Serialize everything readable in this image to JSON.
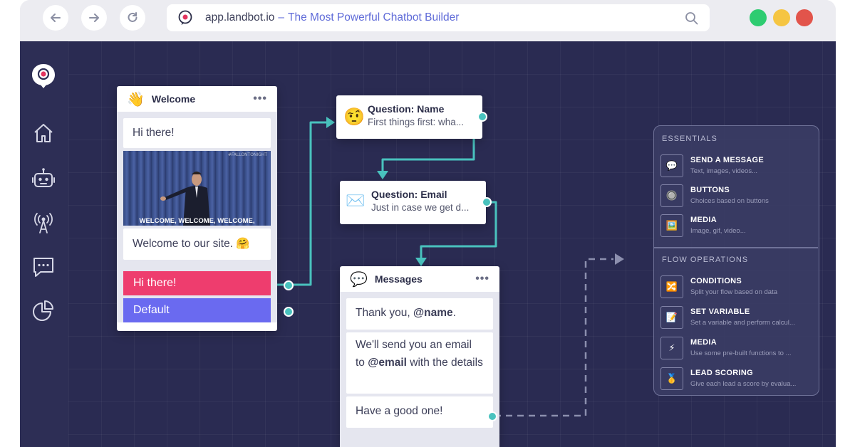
{
  "browser": {
    "url_host": "app.landbot.io",
    "url_separator": "–",
    "url_title": "The Most Powerful Chatbot Builder",
    "nav": {
      "back_icon": "arrow-left-icon",
      "forward_icon": "arrow-right-icon",
      "reload_icon": "reload-icon"
    },
    "traffic_colors": [
      "#2ecc71",
      "#f5c542",
      "#e2544b"
    ]
  },
  "sidebar": {
    "items": [
      {
        "icon": "landbot-logo-icon"
      },
      {
        "icon": "home-icon"
      },
      {
        "icon": "bot-icon"
      },
      {
        "icon": "broadcast-icon"
      },
      {
        "icon": "chat-icon"
      },
      {
        "icon": "pie-chart-icon"
      }
    ]
  },
  "welcome_card": {
    "emoji": "👋",
    "title": "Welcome",
    "menu": "•••",
    "greeting": "Hi there!",
    "gif_caption": "WELCOME, WELCOME, WELCOME,",
    "gif_watermark": "#FALLONTONIGHT",
    "message": "Welcome to our site. 🤗",
    "buttons": [
      {
        "label": "Hi there!",
        "color": "#ee3d6e"
      },
      {
        "label": "Default",
        "color": "#6a6af0"
      }
    ]
  },
  "question_name": {
    "emoji": "🤨",
    "title": "Question: Name",
    "subtitle": "First things first: wha..."
  },
  "question_email": {
    "emoji": "✉️",
    "title": "Question: Email",
    "subtitle": "Just in case we get d..."
  },
  "messages_card": {
    "emoji": "💬",
    "title": "Messages",
    "menu": "•••",
    "bubbles": {
      "thanks_prefix": "Thank you, ",
      "thanks_bold": "@name",
      "thanks_suffix": ".",
      "email_prefix": "We'll send you an email to ",
      "email_bold": "@email",
      "email_suffix": " with the details",
      "good_one": "Have a good one!"
    }
  },
  "blocks_panel": {
    "essentials_title": "ESSENTIALS",
    "flow_title": "FLOW OPERATIONS",
    "essentials": [
      {
        "icon": "💬",
        "title": "SEND A MESSAGE",
        "subtitle": "Text, images, videos..."
      },
      {
        "icon": "🔘",
        "title": "BUTTONS",
        "subtitle": "Choices based on buttons"
      },
      {
        "icon": "🖼️",
        "title": "MEDIA",
        "subtitle": "Image, gif, video..."
      }
    ],
    "flow": [
      {
        "icon": "🔀",
        "title": "CONDITIONS",
        "subtitle": "Split your flow based on data"
      },
      {
        "icon": "📝",
        "title": "SET VARIABLE",
        "subtitle": "Set a variable and perform calcul..."
      },
      {
        "icon": "⚡",
        "title": "MEDIA",
        "subtitle": "Use some pre-built functions to ..."
      },
      {
        "icon": "🥇",
        "title": "LEAD SCORING",
        "subtitle": "Give each lead a score by evalua..."
      }
    ]
  },
  "colors": {
    "canvas": "#2a2b52",
    "connector": "#49c2be",
    "accent": "#5f6bd8"
  }
}
